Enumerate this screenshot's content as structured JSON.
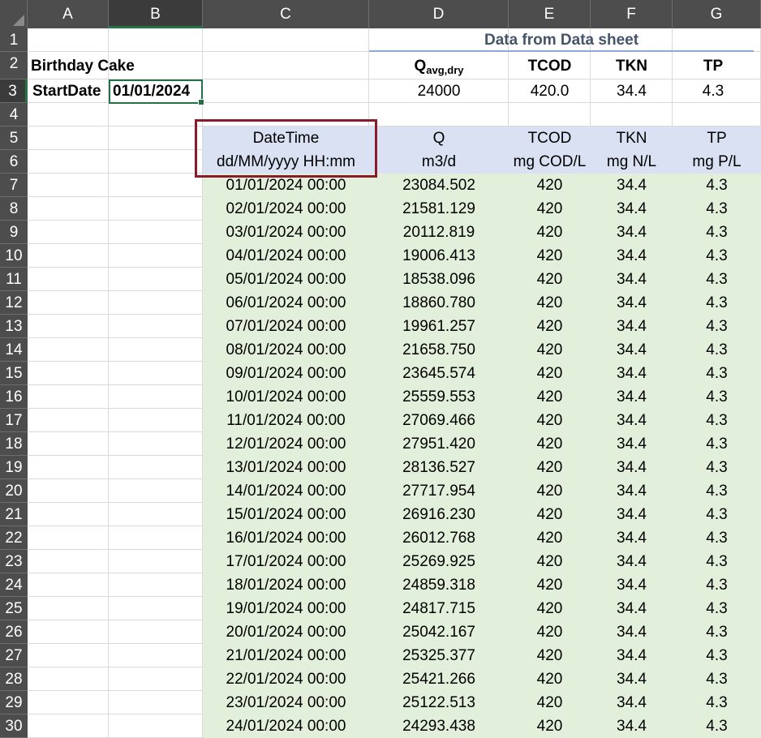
{
  "columns": [
    "A",
    "B",
    "C",
    "D",
    "E",
    "F",
    "G"
  ],
  "rows": [
    "1",
    "2",
    "3",
    "4",
    "5",
    "6",
    "7",
    "8",
    "9",
    "10",
    "11",
    "12",
    "13",
    "14",
    "15",
    "16",
    "17",
    "18",
    "19",
    "20",
    "21",
    "22",
    "23",
    "24",
    "25",
    "26",
    "27",
    "28",
    "29",
    "30"
  ],
  "header_block": {
    "title": "Data from Data sheet",
    "q_label": "Q",
    "q_sub": "avg,dry",
    "tcod": "TCOD",
    "tkn": "TKN",
    "tp": "TP",
    "q_value": "24000",
    "tcod_value": "420.0",
    "tkn_value": "34.4",
    "tp_value": "4.3"
  },
  "labels": {
    "birthday_cake": "Birthday Cake",
    "start_date_label": "StartDate",
    "start_date_value": "01/01/2024"
  },
  "table_headers": {
    "datetime": "DateTime",
    "datetime_fmt": "dd/MM/yyyy HH:mm",
    "q": "Q",
    "q_unit": "m3/d",
    "tcod": "TCOD",
    "tcod_unit": "mg COD/L",
    "tkn": "TKN",
    "tkn_unit": "mg N/L",
    "tp": "TP",
    "tp_unit": "mg P/L"
  },
  "table_rows": [
    [
      "01/01/2024 00:00",
      "23084.502",
      "420",
      "34.4",
      "4.3"
    ],
    [
      "02/01/2024 00:00",
      "21581.129",
      "420",
      "34.4",
      "4.3"
    ],
    [
      "03/01/2024 00:00",
      "20112.819",
      "420",
      "34.4",
      "4.3"
    ],
    [
      "04/01/2024 00:00",
      "19006.413",
      "420",
      "34.4",
      "4.3"
    ],
    [
      "05/01/2024 00:00",
      "18538.096",
      "420",
      "34.4",
      "4.3"
    ],
    [
      "06/01/2024 00:00",
      "18860.780",
      "420",
      "34.4",
      "4.3"
    ],
    [
      "07/01/2024 00:00",
      "19961.257",
      "420",
      "34.4",
      "4.3"
    ],
    [
      "08/01/2024 00:00",
      "21658.750",
      "420",
      "34.4",
      "4.3"
    ],
    [
      "09/01/2024 00:00",
      "23645.574",
      "420",
      "34.4",
      "4.3"
    ],
    [
      "10/01/2024 00:00",
      "25559.553",
      "420",
      "34.4",
      "4.3"
    ],
    [
      "11/01/2024 00:00",
      "27069.466",
      "420",
      "34.4",
      "4.3"
    ],
    [
      "12/01/2024 00:00",
      "27951.420",
      "420",
      "34.4",
      "4.3"
    ],
    [
      "13/01/2024 00:00",
      "28136.527",
      "420",
      "34.4",
      "4.3"
    ],
    [
      "14/01/2024 00:00",
      "27717.954",
      "420",
      "34.4",
      "4.3"
    ],
    [
      "15/01/2024 00:00",
      "26916.230",
      "420",
      "34.4",
      "4.3"
    ],
    [
      "16/01/2024 00:00",
      "26012.768",
      "420",
      "34.4",
      "4.3"
    ],
    [
      "17/01/2024 00:00",
      "25269.925",
      "420",
      "34.4",
      "4.3"
    ],
    [
      "18/01/2024 00:00",
      "24859.318",
      "420",
      "34.4",
      "4.3"
    ],
    [
      "19/01/2024 00:00",
      "24817.715",
      "420",
      "34.4",
      "4.3"
    ],
    [
      "20/01/2024 00:00",
      "25042.167",
      "420",
      "34.4",
      "4.3"
    ],
    [
      "21/01/2024 00:00",
      "25325.377",
      "420",
      "34.4",
      "4.3"
    ],
    [
      "22/01/2024 00:00",
      "25421.266",
      "420",
      "34.4",
      "4.3"
    ],
    [
      "23/01/2024 00:00",
      "25122.513",
      "420",
      "34.4",
      "4.3"
    ],
    [
      "24/01/2024 00:00",
      "24293.438",
      "420",
      "34.4",
      "4.3"
    ]
  ],
  "colors": {
    "header_fill": "#d9e1f2",
    "data_fill": "#e2efda",
    "highlight_border": "#8b1a2b",
    "selection": "#217346",
    "title_text": "#44546a"
  }
}
